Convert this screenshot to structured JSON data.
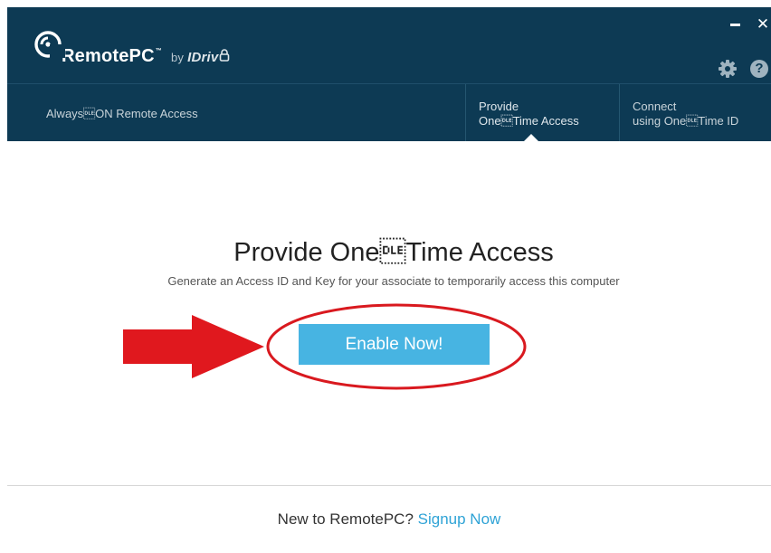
{
  "header": {
    "app_name": "RemotePC",
    "trademark": "™",
    "by_label": "by",
    "brand_name": "IDriv",
    "minimize_label": "",
    "close_label": "✕",
    "settings_icon": "gear-icon",
    "help_label": "?",
    "bg_color": "#0d3a54"
  },
  "nav": {
    "always_on_label": "Always\u0010ON Remote Access",
    "provide_line1": "Provide",
    "provide_line2": "One\u0010Time Access",
    "connect_line1": "Connect",
    "connect_line2": "using One\u0010Time ID"
  },
  "main": {
    "title": "Provide One\u0010Time Access",
    "subtitle": "Generate an Access ID and Key for your associate to temporarily access this computer",
    "enable_button_label": "Enable Now!",
    "button_color": "#47b4e2",
    "annotation_color": "#d9191f"
  },
  "footer": {
    "prompt": "New to RemotePC?",
    "signup_link": "Signup Now",
    "link_color": "#2fa3d6"
  }
}
